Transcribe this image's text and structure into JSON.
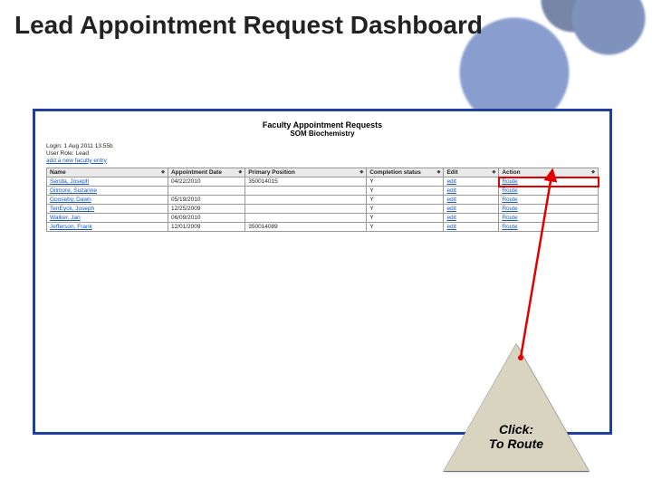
{
  "slide": {
    "title": "Lead Appointment Request Dashboard"
  },
  "screenshot": {
    "heading": "Faculty Appointment Requests",
    "subheading": "SOM Biochemistry",
    "meta_login": "Login: 1 Aug 2011 13:55b",
    "meta_role": "User Role: Lead",
    "meta_addlink": "add a new faculty entry",
    "columns": {
      "name": "Name",
      "date": "Appointment Date",
      "position": "Primary Position",
      "status": "Completion status",
      "edit": "Edit",
      "action": "Action"
    },
    "edit_label": "edit",
    "action_label": "Route",
    "rows": [
      {
        "name": "Senda, Joseph",
        "date": "04/22/2010",
        "position": "350014015",
        "status": "Y"
      },
      {
        "name": "Gilmore, Suzanne",
        "date": "",
        "position": "",
        "status": "Y"
      },
      {
        "name": "Gooseby, Dawn",
        "date": "05/19/2010",
        "position": "",
        "status": "Y"
      },
      {
        "name": "TenEyck, Joseph",
        "date": "12/25/2009",
        "position": "",
        "status": "Y"
      },
      {
        "name": "Walker, Jan",
        "date": "06/09/2010",
        "position": "",
        "status": "Y"
      },
      {
        "name": "Jefferson, Frank",
        "date": "12/01/2009",
        "position": "350014089",
        "status": "Y"
      }
    ]
  },
  "callout": {
    "line1": "Click:",
    "line2": "To Route"
  }
}
